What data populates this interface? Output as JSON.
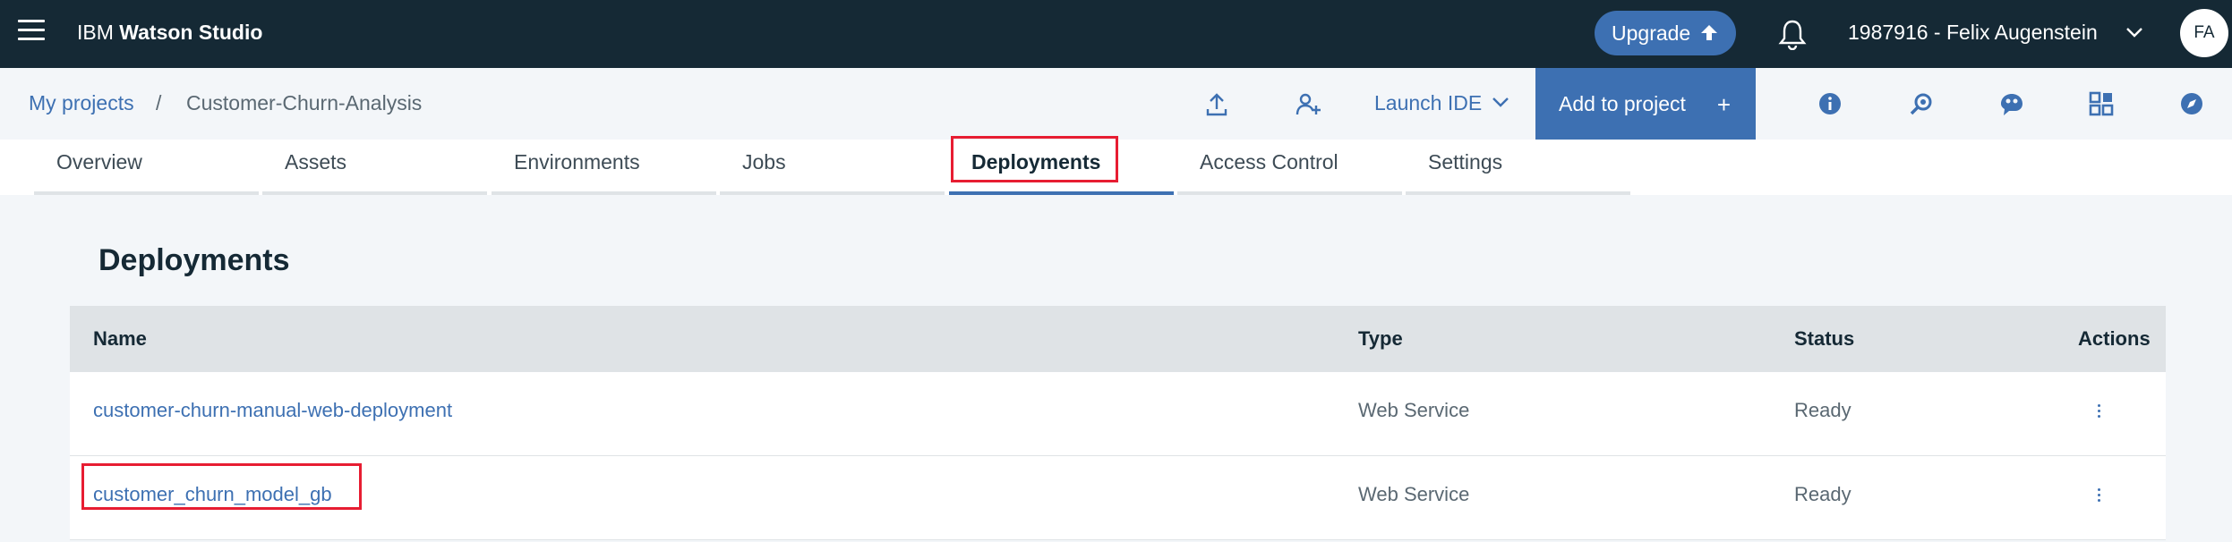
{
  "header": {
    "brand_prefix": "IBM",
    "brand_name": "Watson Studio",
    "upgrade_label": "Upgrade",
    "account_label": "1987916 - Felix Augenstein",
    "avatar_initials": "FA"
  },
  "projectbar": {
    "breadcrumb_root": "My projects",
    "breadcrumb_sep": "/",
    "breadcrumb_current": "Customer-Churn-Analysis",
    "launch_ide_label": "Launch IDE",
    "add_to_project_label": "Add to project",
    "add_icon": "+"
  },
  "tabs": [
    {
      "label": "Overview",
      "active": false
    },
    {
      "label": "Assets",
      "active": false
    },
    {
      "label": "Environments",
      "active": false
    },
    {
      "label": "Jobs",
      "active": false
    },
    {
      "label": "Deployments",
      "active": true
    },
    {
      "label": "Access Control",
      "active": false
    },
    {
      "label": "Settings",
      "active": false
    }
  ],
  "main": {
    "title": "Deployments",
    "columns": {
      "name": "Name",
      "type": "Type",
      "status": "Status",
      "actions": "Actions"
    },
    "rows": [
      {
        "name": "customer-churn-manual-web-deployment",
        "type": "Web Service",
        "status": "Ready",
        "highlighted": false
      },
      {
        "name": "customer_churn_model_gb",
        "type": "Web Service",
        "status": "Ready",
        "highlighted": true
      }
    ]
  },
  "colors": {
    "header_bg": "#152935",
    "accent": "#3d70b2",
    "highlight": "#e71d32",
    "table_header_bg": "#dfe3e6"
  },
  "icons": [
    "hamburger-menu-icon",
    "upload-arrow-icon",
    "bell-icon",
    "chevron-down-icon",
    "upload-icon",
    "add-collaborator-icon",
    "info-icon",
    "search-tool-icon",
    "palette-icon",
    "apps-grid-icon",
    "compass-icon",
    "overflow-menu-icon"
  ]
}
